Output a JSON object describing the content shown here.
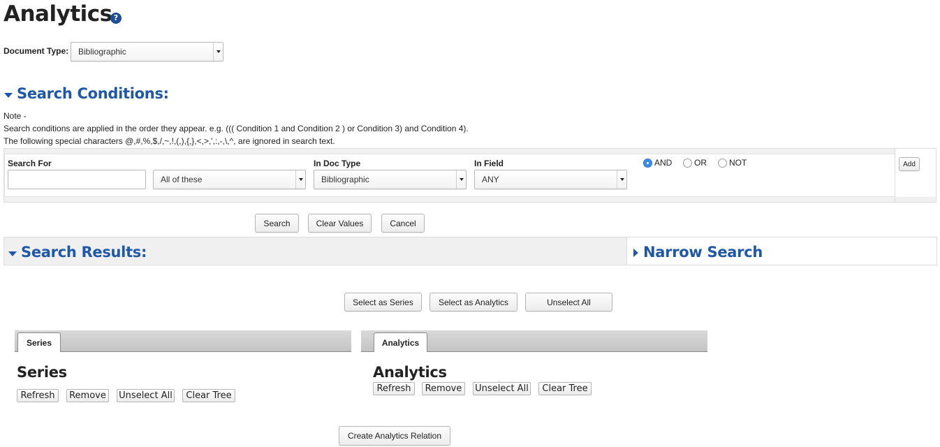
{
  "header": {
    "title": "Analytics",
    "help_glyph": "?"
  },
  "doc_type": {
    "label": "Document Type:",
    "value": "Bibliographic"
  },
  "search_conditions": {
    "title": "Search Conditions:",
    "note_title": "Note -",
    "note_line1": "Search conditions are applied in the order they appear. e.g. ((( Condition 1 and Condition 2 ) or Condition 3) and Condition 4).",
    "note_line2": "The following special characters @,#,%,$,/,~,!,(,),{,},<,>,',:,-,\\,^, are ignored in search text.",
    "search_for_label": "Search For",
    "search_for_value": "",
    "match_value": "All of these",
    "in_doc_type_label": "In Doc Type",
    "in_doc_type_value": "Bibliographic",
    "in_field_label": "In Field",
    "in_field_value": "ANY",
    "operators": [
      {
        "label": "AND",
        "selected": true
      },
      {
        "label": "OR",
        "selected": false
      },
      {
        "label": "NOT",
        "selected": false
      }
    ],
    "add_label": "Add"
  },
  "actions": {
    "search": "Search",
    "clear_values": "Clear Values",
    "cancel": "Cancel"
  },
  "results": {
    "title": "Search Results:",
    "narrow_title": "Narrow Search"
  },
  "selection": {
    "select_series": "Select as Series",
    "select_analytics": "Select as Analytics",
    "unselect_all": "Unselect All"
  },
  "series_panel": {
    "tab": "Series",
    "heading": "Series",
    "refresh": "Refresh",
    "remove": "Remove",
    "unselect_all": "Unselect All",
    "clear_tree": "Clear Tree"
  },
  "analytics_panel": {
    "tab": "Analytics",
    "heading": "Analytics",
    "refresh": "Refresh",
    "remove": "Remove",
    "unselect_all": "Unselect All",
    "clear_tree": "Clear Tree"
  },
  "footer": {
    "create_relation": "Create Analytics Relation"
  },
  "colors": {
    "accent": "#1f58a8",
    "radio_selected": "#3b8ee8",
    "help_icon": "#1f4e96"
  },
  "icons": [
    "help-icon",
    "chevron-down-icon",
    "collapse-triangle-icon",
    "expand-triangle-icon"
  ]
}
